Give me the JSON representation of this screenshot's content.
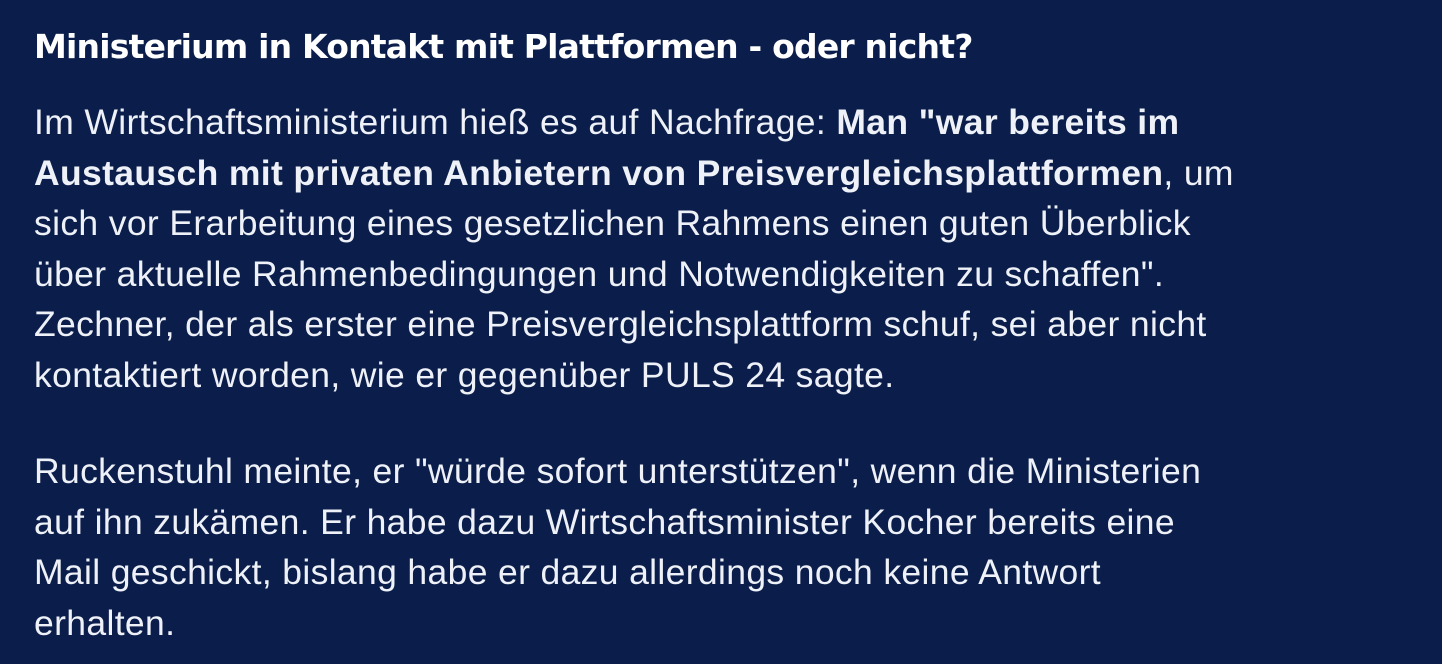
{
  "article": {
    "headline": "Ministerium in Kontakt mit Plattformen - oder nicht?",
    "paragraph1": {
      "l1_plain": "Im Wirtschaftsministerium hieß es auf Nachfrage: ",
      "l1_bold": "Man \"war bereits im",
      "l2_bold": "Austausch mit privaten Anbietern von Preisvergleichsplattformen",
      "l2_plain": ", um",
      "l3": "sich vor Erarbeitung eines gesetzlichen Rahmens einen guten Überblick",
      "l4": "über aktuelle Rahmenbedingungen und Notwendigkeiten zu schaffen\".",
      "l5": "Zechner, der als erster eine Preisvergleichsplattform schuf, sei aber nicht",
      "l6": "kontaktiert worden, wie er gegenüber PULS 24 sagte."
    },
    "paragraph2": {
      "l1": "Ruckenstuhl meinte, er \"würde sofort unterstützen\", wenn die Ministerien",
      "l2": "auf ihn zukämen. Er habe dazu Wirtschaftsminister Kocher bereits eine",
      "l3": "Mail geschickt, bislang habe er dazu allerdings noch keine Antwort",
      "l4": "erhalten."
    }
  }
}
